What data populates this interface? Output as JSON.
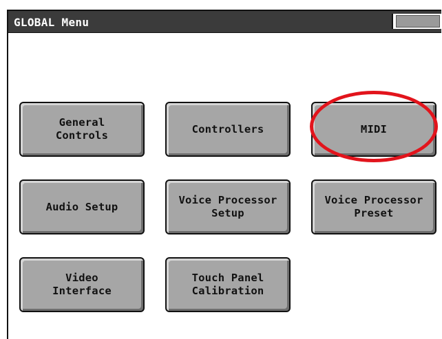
{
  "window": {
    "title": "GLOBAL Menu"
  },
  "menu": {
    "buttons": [
      {
        "label": "General\nControls"
      },
      {
        "label": "Controllers"
      },
      {
        "label": "MIDI"
      },
      {
        "label": "Audio Setup"
      },
      {
        "label": "Voice Processor\nSetup"
      },
      {
        "label": "Voice Processor\nPreset"
      },
      {
        "label": "Video\nInterface"
      },
      {
        "label": "Touch Panel\nCalibration"
      }
    ]
  },
  "colors": {
    "titlebar": "#3b3b3b",
    "button_face": "#a6a6a6",
    "highlight_ring": "#e2141c"
  }
}
